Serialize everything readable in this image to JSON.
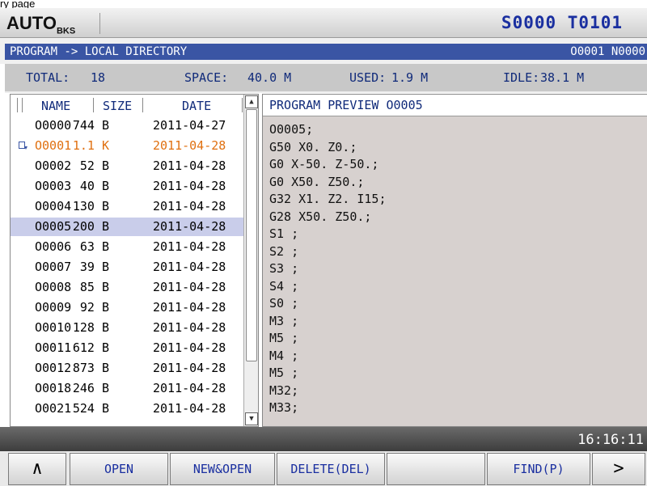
{
  "caption": "ry page",
  "header": {
    "mode": "AUTO",
    "mode_sub": "BKS",
    "spindle_tool": "S0000 T0101"
  },
  "path": {
    "label": "PROGRAM -> LOCAL DIRECTORY",
    "program_number": "O0001 N0000"
  },
  "stats": {
    "total_label": "TOTAL:",
    "total_value": "18",
    "space_label": "SPACE:",
    "space_value": "40.0 M",
    "used_label": "USED:",
    "used_value": "1.9 M",
    "idle_label": "IDLE:",
    "idle_value": "38.1 M"
  },
  "list": {
    "columns": [
      "NAME",
      "SIZE",
      "DATE"
    ],
    "rows": [
      {
        "name": "O0000",
        "size": "744 B",
        "date": "2011-04-27"
      },
      {
        "name": "O0001",
        "size": "1.1 K",
        "date": "2011-04-28"
      },
      {
        "name": "O0002",
        "size": "52 B",
        "date": "2011-04-28"
      },
      {
        "name": "O0003",
        "size": "40 B",
        "date": "2011-04-28"
      },
      {
        "name": "O0004",
        "size": "130 B",
        "date": "2011-04-28"
      },
      {
        "name": "O0005",
        "size": "200 B",
        "date": "2011-04-28"
      },
      {
        "name": "O0006",
        "size": "63 B",
        "date": "2011-04-28"
      },
      {
        "name": "O0007",
        "size": "39 B",
        "date": "2011-04-28"
      },
      {
        "name": "O0008",
        "size": "85 B",
        "date": "2011-04-28"
      },
      {
        "name": "O0009",
        "size": "92 B",
        "date": "2011-04-28"
      },
      {
        "name": "O0010",
        "size": "128 B",
        "date": "2011-04-28"
      },
      {
        "name": "O0011",
        "size": "612 B",
        "date": "2011-04-28"
      },
      {
        "name": "O0012",
        "size": "873 B",
        "date": "2011-04-28"
      },
      {
        "name": "O0018",
        "size": "246 B",
        "date": "2011-04-28"
      },
      {
        "name": "O0021",
        "size": "524 B",
        "date": "2011-04-28"
      }
    ],
    "active_program": "O0001",
    "selected_program": "O0005"
  },
  "preview": {
    "title": "PROGRAM PREVIEW O0005",
    "lines": [
      "O0005;",
      "G50 X0. Z0.;",
      "G0 X-50. Z-50.;",
      "G0 X50. Z50.;",
      "G32 X1. Z2. I15;",
      "G28 X50. Z50.;",
      "S1 ;",
      "S2 ;",
      "S3 ;",
      "S4 ;",
      "S0 ;",
      "M3 ;",
      "M5 ;",
      "M4 ;",
      "M5 ;",
      "M32;",
      "M33;"
    ]
  },
  "status": {
    "time": "16:16:11"
  },
  "softkeys": {
    "back": "∧",
    "open": "OPEN",
    "new_open": "NEW&OPEN",
    "delete": "DELETE(DEL)",
    "empty": "",
    "find": "FIND(P)",
    "next": ">"
  }
}
